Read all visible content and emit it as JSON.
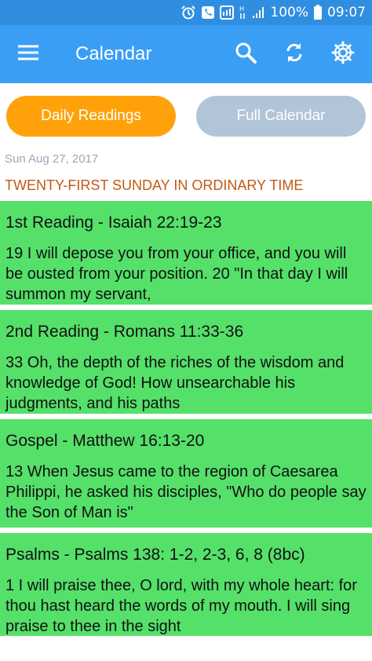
{
  "status_bar": {
    "battery": "100%",
    "time": "09:07",
    "icons": [
      "alarm-icon",
      "phone-icon",
      "nfc-icon",
      "h-signal-icon",
      "signal-icon",
      "battery-icon"
    ]
  },
  "appbar": {
    "title": "Calendar",
    "icons": [
      "menu-icon",
      "search-icon",
      "sync-icon",
      "gear-icon"
    ]
  },
  "tabs": {
    "daily": "Daily Readings",
    "full": "Full Calendar",
    "active": "daily"
  },
  "date": "Sun Aug 27, 2017",
  "day_title": "TWENTY-FIRST SUNDAY IN ORDINARY TIME",
  "readings": [
    {
      "title": "1st Reading - Isaiah 22:19-23",
      "text": "19 I will depose you from your office, and you will be ousted from your position. 20 \"In that day I will summon my servant,"
    },
    {
      "title": "2nd Reading - Romans 11:33-36",
      "text": "33 Oh, the depth of the riches of the wisdom and knowledge of God! How unsearchable his judgments, and his paths"
    },
    {
      "title": "Gospel - Matthew 16:13-20",
      "text": "13 When Jesus came to the region of Caesarea Philippi, he asked his disciples, \"Who do people say the Son of Man is\""
    },
    {
      "title": "Psalms - Psalms 138: 1-2, 2-3, 6, 8 (8bc)",
      "text": "1 I will praise thee, O lord, with my whole heart: for thou hast heard the words of my mouth. I will sing praise to thee in the sight"
    }
  ],
  "colors": {
    "statusbar": "#2f8ee0",
    "appbar": "#3b9ef5",
    "tab_active": "#ffa20a",
    "tab_inactive": "#b2c4d8",
    "card": "#55e06a",
    "day_title": "#c25a14",
    "date": "#9aa8b8"
  }
}
